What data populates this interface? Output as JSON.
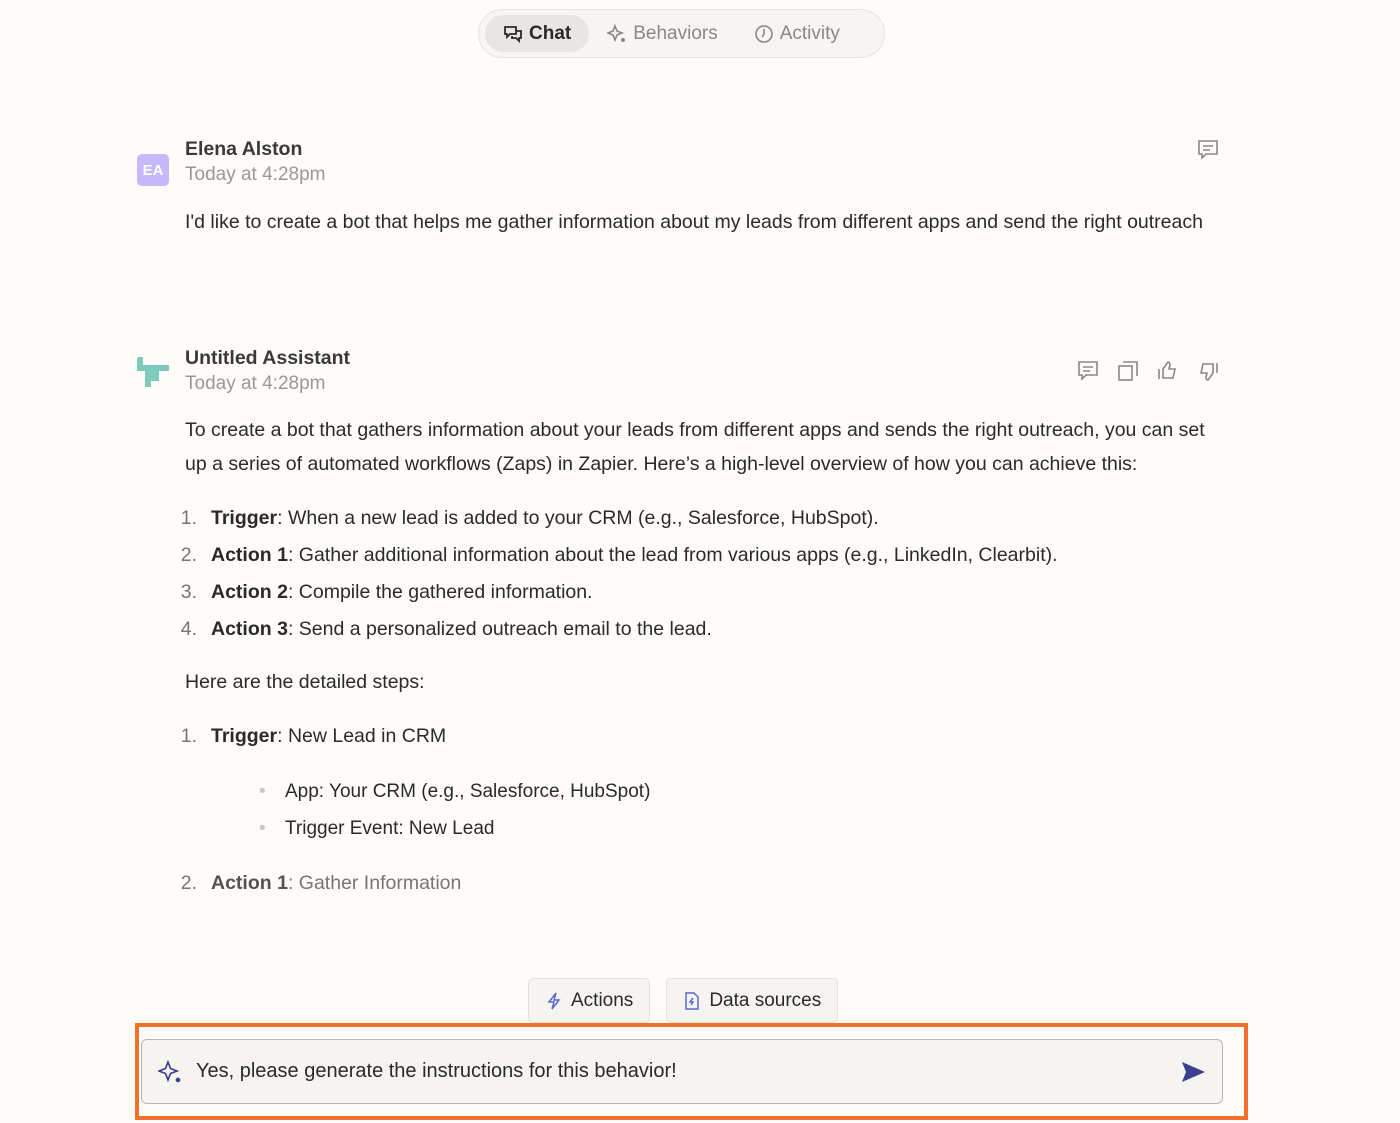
{
  "tabs": [
    {
      "label": "Chat",
      "icon": "chat-icon",
      "active": true
    },
    {
      "label": "Behaviors",
      "icon": "sparkle-icon"
    },
    {
      "label": "Activity",
      "icon": "clock-icon"
    }
  ],
  "messages": [
    {
      "avatar": "EA",
      "avatar_color": "#c5b8fb",
      "name": "Elena Alston",
      "time": "Today at 4:28pm",
      "text": "I'd like to create a bot that helps me gather information about my leads from different apps and send the right outreach"
    },
    {
      "avatar_color": "#7ecbbd",
      "name": "Untitled Assistant",
      "time": "Today at 4:28pm",
      "intro": "To create a bot that gathers information about your leads from different apps and sends the right outreach, you can set up a series of automated workflows (Zaps) in Zapier. Here’s a high-level overview of how you can achieve this:",
      "overview": [
        {
          "n": "1.",
          "b": "Trigger",
          "t": ": When a new lead is added to your CRM (e.g., Salesforce, HubSpot)."
        },
        {
          "n": "2.",
          "b": "Action 1",
          "t": ": Gather additional information about the lead from various apps (e.g., LinkedIn, Clearbit)."
        },
        {
          "n": "3.",
          "b": "Action 2",
          "t": ": Compile the gathered information."
        },
        {
          "n": "4.",
          "b": "Action 3",
          "t": ": Send a personalized outreach email to the lead."
        }
      ],
      "steps_heading": "Here are the detailed steps:",
      "step1": {
        "n": "1.",
        "b": "Trigger",
        "t": ": New Lead in CRM",
        "bullets": [
          "App: Your CRM (e.g., Salesforce, HubSpot)",
          "Trigger Event: New Lead"
        ]
      },
      "step2": {
        "n": "2.",
        "b": "Action 1",
        "t": ": Gather Information"
      }
    }
  ],
  "chips": [
    {
      "label": "Actions",
      "icon": "lightning-icon"
    },
    {
      "label": "Data sources",
      "icon": "document-icon"
    }
  ],
  "composer": {
    "value": "Yes, please generate the instructions for this behavior!",
    "highlight_color": "#f0702c",
    "send_color": "#3b3f8f"
  }
}
